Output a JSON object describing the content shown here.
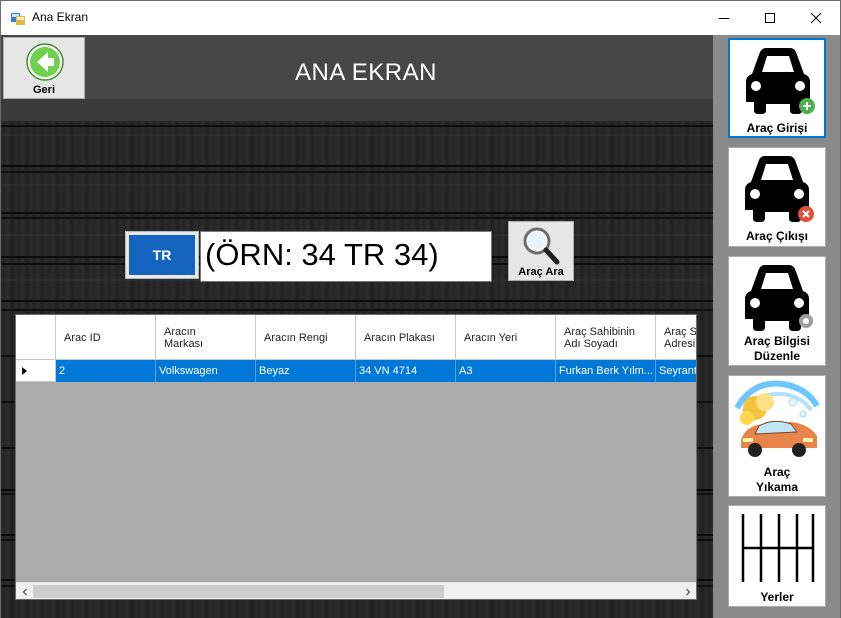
{
  "window": {
    "title": "Ana Ekran"
  },
  "header": {
    "title": "ANA EKRAN",
    "back_label": "Geri"
  },
  "search": {
    "country_code": "TR",
    "plate_value": "(ÖRN: 34 TR 34)",
    "button_label": "Araç Ara"
  },
  "grid": {
    "columns": [
      "Arac ID",
      "Aracın\nMarkası",
      "Aracın Rengi",
      "Aracın Plakası",
      "Aracın Yeri",
      "Araç Sahibinin\nAdı Soyadı",
      "Araç S\nAdresi"
    ],
    "rows": [
      [
        "2",
        "Volkswagen",
        "Beyaz",
        "34 VN 4714",
        "A3",
        "Furkan Berk Yılm...",
        "Seyrant"
      ]
    ]
  },
  "nav": {
    "arac_girisi": "Araç Girişi",
    "arac_cikisi": "Araç Çıkışı",
    "arac_bilgisi_line1": "Araç Bilgisi",
    "arac_bilgisi_line2": "Düzenle",
    "arac_yikama_line1": "Araç",
    "arac_yikama_line2": "Yıkama",
    "yerler": "Yerler"
  },
  "colors": {
    "selection": "#0078d7",
    "country_badge": "#1565c0",
    "back_arrow": "#5cc84a",
    "add_badge": "#4caf50",
    "remove_badge": "#e0503a"
  }
}
